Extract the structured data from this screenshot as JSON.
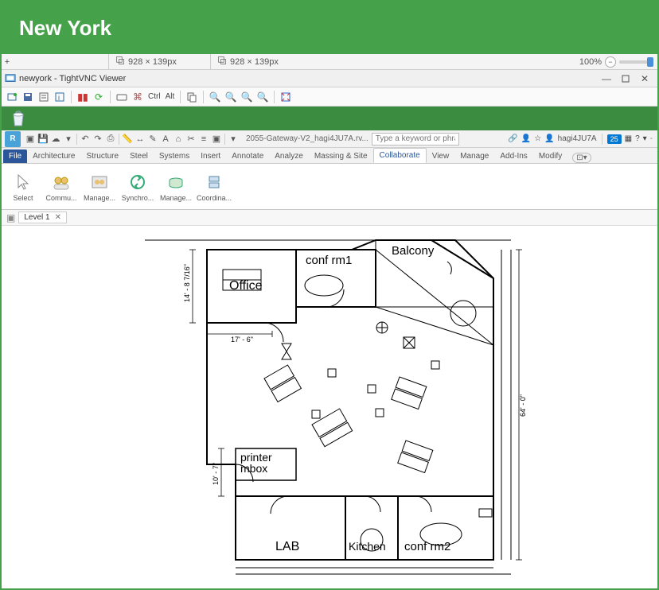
{
  "banner": {
    "title": "New York"
  },
  "dimbar": {
    "left_dim": "928 × 139px",
    "right_dim": "928 × 139px",
    "zoom": "100%"
  },
  "vnc": {
    "title": "newyork - TightVNC Viewer",
    "keys": {
      "ctrl": "Ctrl",
      "alt": "Alt"
    }
  },
  "qat": {
    "document": "2055-Gateway-V2_hagi4JU7A.rv...",
    "search_placeholder": "Type a keyword or phrase",
    "user": "hagi4JU7A",
    "badge": "25"
  },
  "ribbon": {
    "tabs": [
      "File",
      "Architecture",
      "Structure",
      "Steel",
      "Systems",
      "Insert",
      "Annotate",
      "Analyze",
      "Massing & Site",
      "Collaborate",
      "View",
      "Manage",
      "Add-Ins",
      "Modify"
    ],
    "active_tab": "Collaborate",
    "panel_buttons": [
      "Select",
      "Commu...",
      "Manage...",
      "Synchro...",
      "Manage...",
      "Coordina..."
    ]
  },
  "doc_tab": {
    "label": "Level 1"
  },
  "floorplan": {
    "rooms": {
      "office": "Office",
      "conf1": "conf rm1",
      "balcony": "Balcony",
      "printer": "printer\nmbox",
      "lab": "LAB",
      "kitchen": "Kitchen",
      "conf2": "conf rm2"
    },
    "dims": {
      "left1": "14' - 8 7/16\"",
      "bottom_small": "17' - 6\"",
      "left2": "10' - 7\"",
      "right": "64' - 0\""
    }
  }
}
